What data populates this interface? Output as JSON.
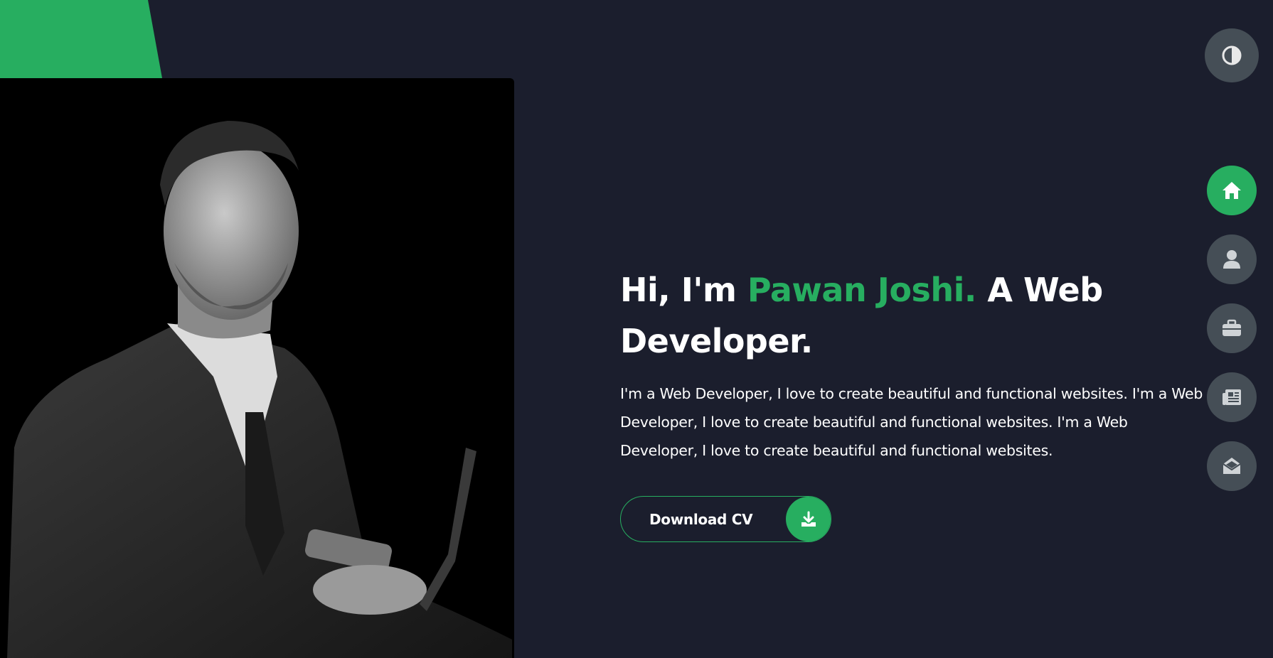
{
  "colors": {
    "background": "#1b1e2d",
    "accent": "#27ae60",
    "nav_button": "#454e56",
    "text": "#ffffff"
  },
  "hero": {
    "greeting": "Hi, I'm ",
    "name": "Pawan Joshi.",
    "role": " A Web Developer.",
    "description": "I'm a Web Developer, I love to create beautiful and functional websites. I'm a Web Developer, I love to create beautiful and functional websites. I'm a Web Developer, I love to create beautiful and functional websites."
  },
  "cv_button": {
    "label": "Download CV",
    "icon": "download-icon"
  },
  "theme_toggle": {
    "icon": "contrast-icon"
  },
  "nav": {
    "items": [
      {
        "id": "home",
        "icon": "home-icon",
        "active": true
      },
      {
        "id": "about",
        "icon": "user-icon",
        "active": false
      },
      {
        "id": "portfolio",
        "icon": "briefcase-icon",
        "active": false
      },
      {
        "id": "blog",
        "icon": "newspaper-icon",
        "active": false
      },
      {
        "id": "contact",
        "icon": "envelope-open-icon",
        "active": false
      }
    ]
  },
  "photo": {
    "alt_icon": "portrait-photo"
  }
}
